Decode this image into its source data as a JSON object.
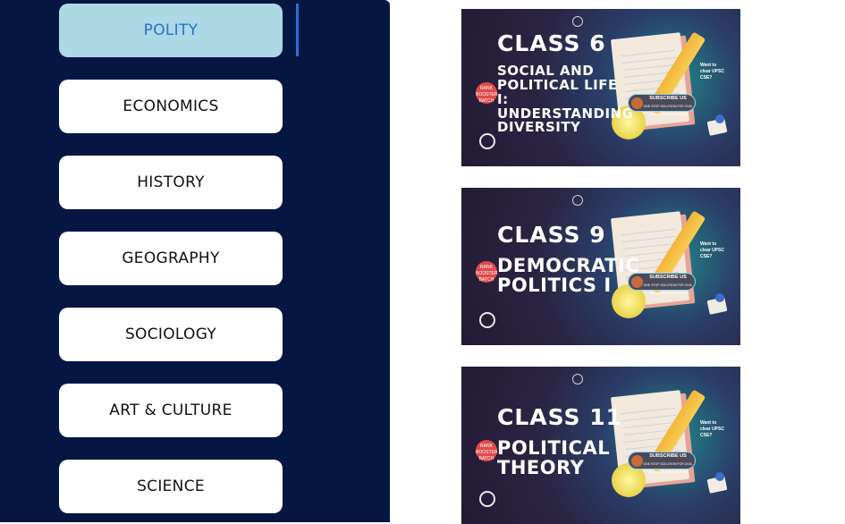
{
  "sidebar": {
    "items": [
      {
        "label": "POLITY",
        "active": true
      },
      {
        "label": "ECONOMICS",
        "active": false
      },
      {
        "label": "HISTORY",
        "active": false
      },
      {
        "label": "GEOGRAPHY",
        "active": false
      },
      {
        "label": "SOCIOLOGY",
        "active": false
      },
      {
        "label": "ART & CULTURE",
        "active": false
      },
      {
        "label": "SCIENCE",
        "active": false
      }
    ]
  },
  "videos": [
    {
      "class_label": "CLASS 6",
      "title_lines": [
        "SOCIAL AND",
        "POLITICAL LIFE I:",
        "UNDERSTANDING",
        "DIVERSITY"
      ],
      "subscribe": "SUBSCRIBE US",
      "subscribe_sub": "ONE STOP SOLUTION FOR CIVIL SERVICES PREPARATION",
      "side_note": "Want to clear UPSC CSE?",
      "badge": "RANK BOOSTER BATCH"
    },
    {
      "class_label": "CLASS 9",
      "title_lines": [
        "DEMOCRATIC",
        "POLITICS I"
      ],
      "subscribe": "SUBSCRIBE US",
      "subscribe_sub": "ONE STOP SOLUTION FOR CIVIL SERVICES PREPARATION",
      "side_note": "Want to clear UPSC CSE?",
      "badge": "RANK BOOSTER BATCH"
    },
    {
      "class_label": "CLASS 11",
      "title_lines": [
        "POLITICAL",
        "THEORY"
      ],
      "subscribe": "SUBSCRIBE US",
      "subscribe_sub": "ONE STOP SOLUTION FOR CIVIL SERVICES PREPARATION",
      "side_note": "Want to clear UPSC CSE?",
      "badge": "RANK BOOSTER BATCH"
    }
  ],
  "colors": {
    "sidebar_bg": "#061642",
    "active_bg": "#add8e6",
    "active_text": "#2a6fcf",
    "indicator": "#2f6fd6"
  }
}
